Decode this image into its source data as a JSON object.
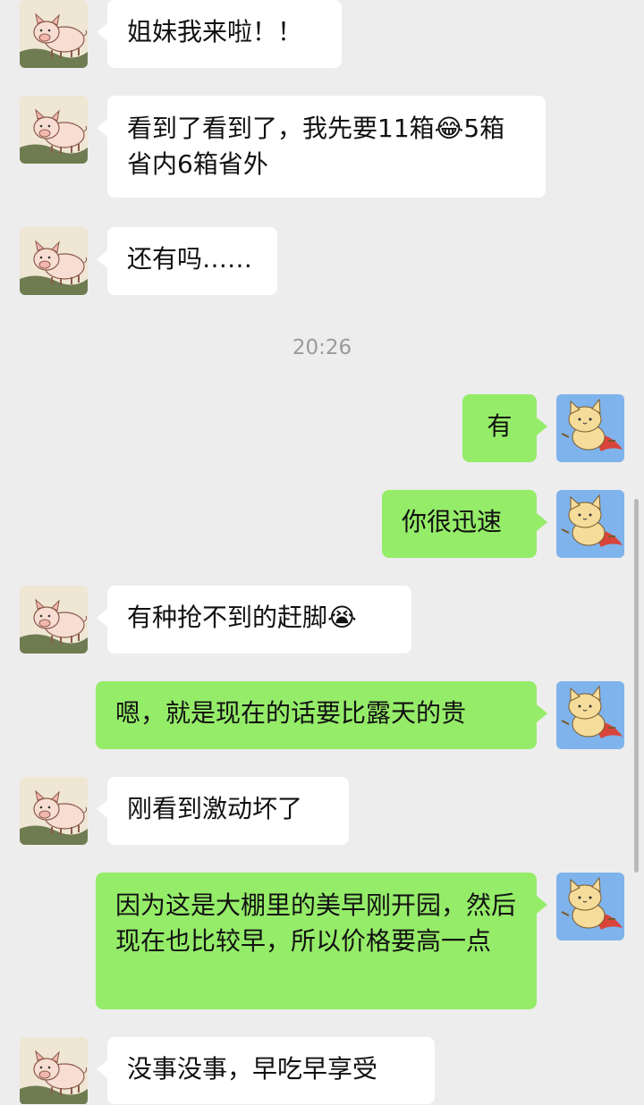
{
  "conversation": {
    "timestamp": "20:26",
    "messages": [
      {
        "side": "in",
        "text": "姐妹我来啦！！"
      },
      {
        "side": "in",
        "text": "看到了看到了，我先要11箱",
        "emoji": "😂",
        "text2": "5箱省内6箱省外"
      },
      {
        "side": "in",
        "text": "还有吗……"
      },
      {
        "side": "out",
        "text": "有"
      },
      {
        "side": "out",
        "text": "你很迅速"
      },
      {
        "side": "in",
        "text": "有种抢不到的赶脚",
        "emoji": "😭"
      },
      {
        "side": "out",
        "text": "嗯，就是现在的话要比露天的贵"
      },
      {
        "side": "in",
        "text": "刚看到激动坏了"
      },
      {
        "side": "out",
        "text": "因为这是大棚里的美早刚开园，然后现在也比较早，所以价格要高一点"
      },
      {
        "side": "in",
        "text": "没事没事，早吃早享受"
      }
    ]
  },
  "avatars": {
    "contact": "pig-avatar-icon",
    "me": "cat-avatar-icon"
  },
  "colors": {
    "background": "#ededed",
    "incoming_bubble": "#ffffff",
    "outgoing_bubble": "#95ec69",
    "timestamp": "#9a9a9a"
  }
}
